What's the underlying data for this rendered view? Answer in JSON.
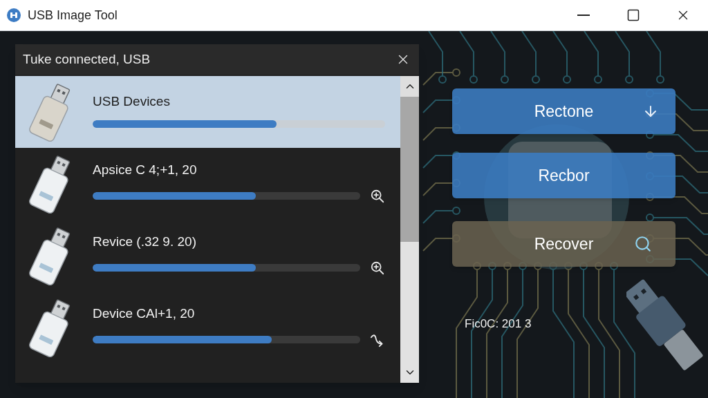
{
  "window": {
    "title": "USB Image Tool"
  },
  "device_panel": {
    "title": "Tuke connected, USB",
    "devices": [
      {
        "name": "USB Devices",
        "level": 0.63,
        "selected": true,
        "kind": "plain"
      },
      {
        "name": "Apsice C 4;+1, 20",
        "level": 0.61,
        "selected": false,
        "kind": "inspect"
      },
      {
        "name": "Revice (.32 9. 20)",
        "level": 0.61,
        "selected": false,
        "kind": "inspect"
      },
      {
        "name": "Device CAl+1, 20",
        "level": 0.67,
        "selected": false,
        "kind": "transfer"
      }
    ]
  },
  "actions": [
    {
      "label": "Rectone",
      "kind": "download"
    },
    {
      "label": "Recbor",
      "kind": "plain"
    },
    {
      "label": "Recover",
      "kind": "search"
    }
  ],
  "status_text": "Fic0C: 201 3"
}
